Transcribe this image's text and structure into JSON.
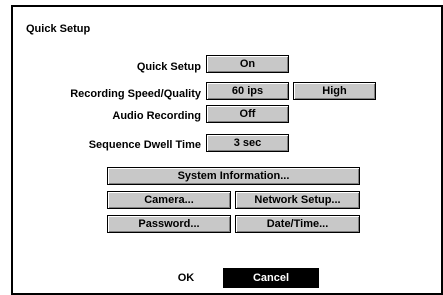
{
  "dialog": {
    "title": "Quick Setup"
  },
  "settings": {
    "quick_setup_label": "Quick Setup",
    "quick_setup_value": "On",
    "recording_speed_label": "Recording Speed/Quality",
    "recording_speed_value": "60 ips",
    "recording_quality_value": "High",
    "audio_recording_label": "Audio Recording",
    "audio_recording_value": "Off",
    "sequence_dwell_label": "Sequence Dwell Time",
    "sequence_dwell_value": "3 sec"
  },
  "buttons": {
    "system_information": "System Information...",
    "camera": "Camera...",
    "network_setup": "Network Setup...",
    "password": "Password...",
    "date_time": "Date/Time..."
  },
  "footer": {
    "ok": "OK",
    "cancel": "Cancel"
  }
}
